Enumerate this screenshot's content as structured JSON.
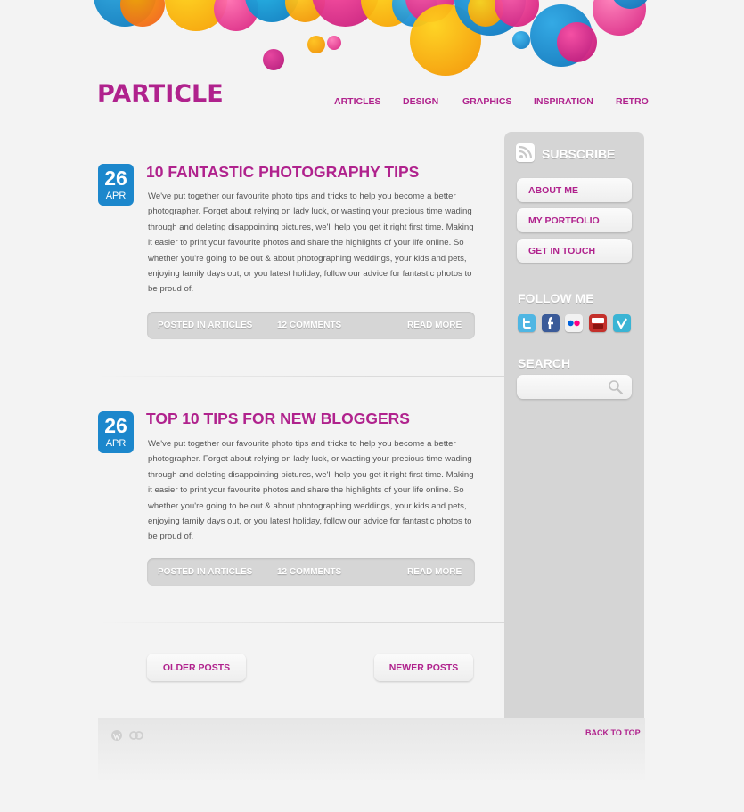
{
  "site": {
    "logo": "PARTICLE"
  },
  "nav": {
    "items": [
      {
        "label": "ARTICLES"
      },
      {
        "label": "DESIGN"
      },
      {
        "label": "GRAPHICS"
      },
      {
        "label": "INSPIRATION"
      },
      {
        "label": "RETRO"
      }
    ]
  },
  "posts": [
    {
      "day": "26",
      "month": "APR",
      "title": "10 FANTASTIC PHOTOGRAPHY TIPS",
      "body": "We've put together our favourite photo tips and tricks to help you become a better photographer. Forget about relying on lady luck, or wasting your precious time wading through and deleting disappointing pictures, we'll help you get it right first time. Making it easier to print your favourite photos and share the highlights of your life online. So whether you're going to be out & about photographing weddings, your kids and pets, enjoying family days out, or you latest holiday, follow our advice for fantastic photos to be proud of.",
      "posted_in": "POSTED IN ARTICLES",
      "comments": "12 COMMENTS",
      "read_more": "READ MORE"
    },
    {
      "day": "26",
      "month": "APR",
      "title": "TOP 10 TIPS FOR NEW BLOGGERS",
      "body": "We've put together our favourite photo tips and tricks to help you become a better photographer. Forget about relying on lady luck, or wasting your precious time wading through and deleting disappointing pictures, we'll help you get it right first time. Making it easier to print your favourite photos and share the highlights of your life online. So whether you're going to be out & about photographing weddings, your kids and pets, enjoying family days out, or you latest holiday, follow our advice for fantastic photos to be proud of.",
      "posted_in": "POSTED IN ARTICLES",
      "comments": "12 COMMENTS",
      "read_more": "READ MORE"
    }
  ],
  "pagination": {
    "older": "OLDER POSTS",
    "newer": "NEWER POSTS"
  },
  "sidebar": {
    "subscribe": "SUBSCRIBE",
    "links": [
      {
        "label": "ABOUT ME"
      },
      {
        "label": "MY PORTFOLIO"
      },
      {
        "label": "GET IN TOUCH"
      }
    ],
    "follow_heading": "FOLLOW ME",
    "social": [
      {
        "icon": "twitter-icon",
        "color": "#4fb6e3"
      },
      {
        "icon": "facebook-icon",
        "color": "#3b5b99"
      },
      {
        "icon": "flickr-icon",
        "color": "#f0f0f0"
      },
      {
        "icon": "youtube-icon",
        "color": "#c4302b"
      },
      {
        "icon": "vimeo-icon",
        "color": "#3ab4d4"
      }
    ],
    "search_heading": "SEARCH",
    "search_placeholder": ""
  },
  "footer": {
    "back_to_top": "BACK TO TOP"
  },
  "colors": {
    "brand": "#b0228d",
    "date_badge": "#1c87cc",
    "sidebar_bg": "#d5d5d5",
    "page_bg": "#f3f3f3"
  }
}
